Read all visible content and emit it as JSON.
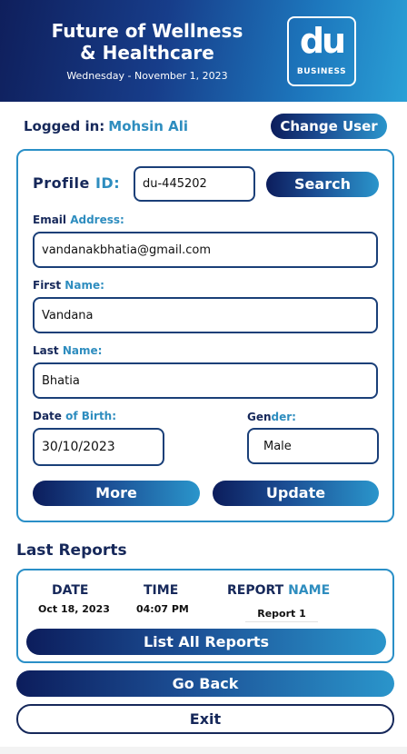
{
  "header": {
    "title_line1": "Future of Wellness",
    "title_line2": "& Healthcare",
    "date": "Wednesday - November 1, 2023",
    "logo_mark": "du",
    "logo_sub": "BUSINESS"
  },
  "session": {
    "logged_in_label": "Logged in:",
    "user_name": "Mohsin Ali",
    "change_user_label": "Change User"
  },
  "form": {
    "profile_id_label_1": "Profile",
    "profile_id_label_2": "ID:",
    "profile_id_value": "du-445202",
    "search_label": "Search",
    "email_label_1": "Email",
    "email_label_2": "Address:",
    "email_value": "vandanakbhatia@gmail.com",
    "first_name_label_1": "First",
    "first_name_label_2": "Name:",
    "first_name_value": "Vandana",
    "last_name_label_1": "Last",
    "last_name_label_2": "Name:",
    "last_name_value": "Bhatia",
    "dob_label_1": "Date",
    "dob_label_2": "of Birth:",
    "dob_value": "30/10/2023",
    "gender_label_1": "Gen",
    "gender_label_2": "der:",
    "gender_value": "Male",
    "more_label": "More",
    "update_label": "Update"
  },
  "reports": {
    "title": "Last Reports",
    "col_date": "DATE",
    "col_time": "TIME",
    "col_name_1": "REPORT",
    "col_name_2": "NAME",
    "rows": [
      {
        "date": "Oct 18, 2023",
        "time": "04:07 PM",
        "name": "Report 1"
      }
    ],
    "list_all_label": "List All Reports"
  },
  "nav": {
    "go_back_label": "Go Back",
    "exit_label": "Exit"
  },
  "colors": {
    "navy": "#16285a",
    "accent_blue": "#2e8dbf",
    "border_blue": "#2a8fc7"
  }
}
